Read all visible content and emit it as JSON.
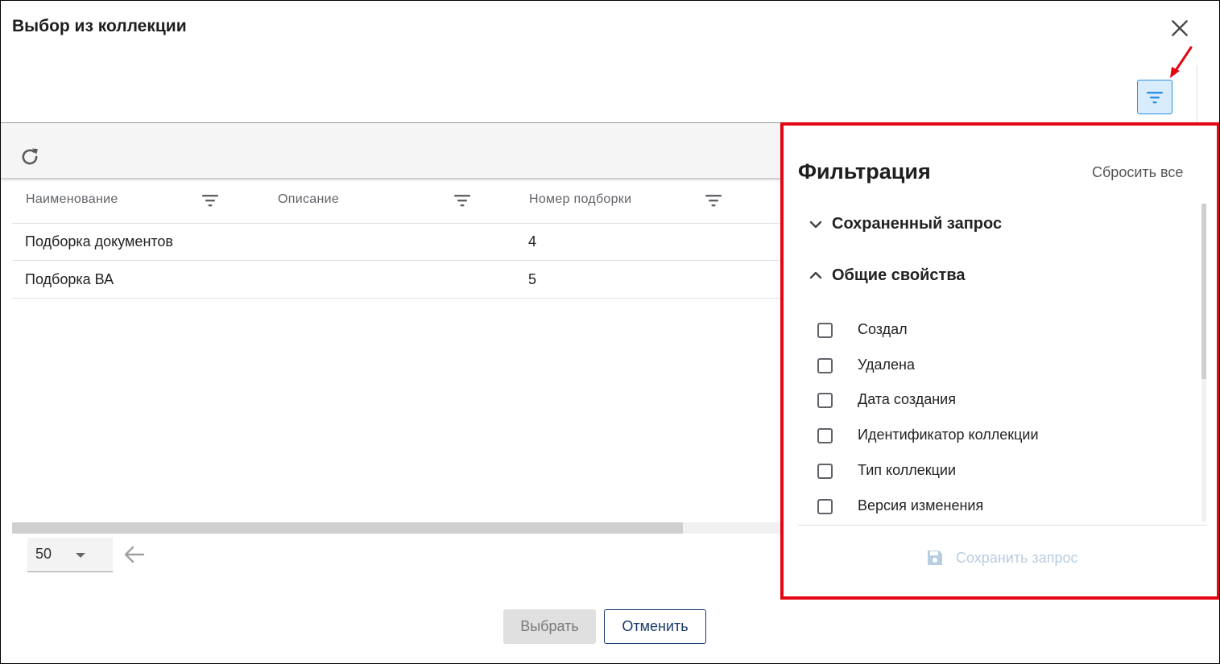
{
  "dialog": {
    "title": "Выбор из коллекции"
  },
  "icons": {
    "close": "close-icon",
    "filter": "filter-icon",
    "refresh": "refresh-icon",
    "arrow_back": "arrow-left-icon",
    "caret": "caret-down-icon",
    "chevron_down": "chevron-down-icon",
    "chevron_up": "chevron-up-icon",
    "save": "floppy-disk-icon"
  },
  "colors": {
    "accent_blue": "#2f8ee0",
    "highlight_red": "#e30613",
    "cancel_navy": "#1a3a6b",
    "disabled_text": "#b9cde0"
  },
  "grid": {
    "columns": [
      {
        "label": "Наименование"
      },
      {
        "label": "Описание"
      },
      {
        "label": "Номер подборки"
      }
    ],
    "rows": [
      {
        "name": "Подборка документов",
        "description": "",
        "number": "4"
      },
      {
        "name": "Подборка ВА",
        "description": "",
        "number": "5"
      }
    ]
  },
  "pagination": {
    "page_size": "50"
  },
  "footer": {
    "select_label": "Выбрать",
    "cancel_label": "Отменить"
  },
  "filter_panel": {
    "title": "Фильтрация",
    "reset_label": "Сбросить все",
    "sections": [
      {
        "label": "Сохраненный запрос",
        "expanded": false
      },
      {
        "label": "Общие свойства",
        "expanded": true
      }
    ],
    "properties": [
      {
        "label": "Создал",
        "checked": false
      },
      {
        "label": "Удалена",
        "checked": false
      },
      {
        "label": "Дата создания",
        "checked": false
      },
      {
        "label": "Идентификатор коллекции",
        "checked": false
      },
      {
        "label": "Тип коллекции",
        "checked": false
      },
      {
        "label": "Версия изменения",
        "checked": false
      }
    ],
    "save_label": "Сохранить запрос"
  }
}
